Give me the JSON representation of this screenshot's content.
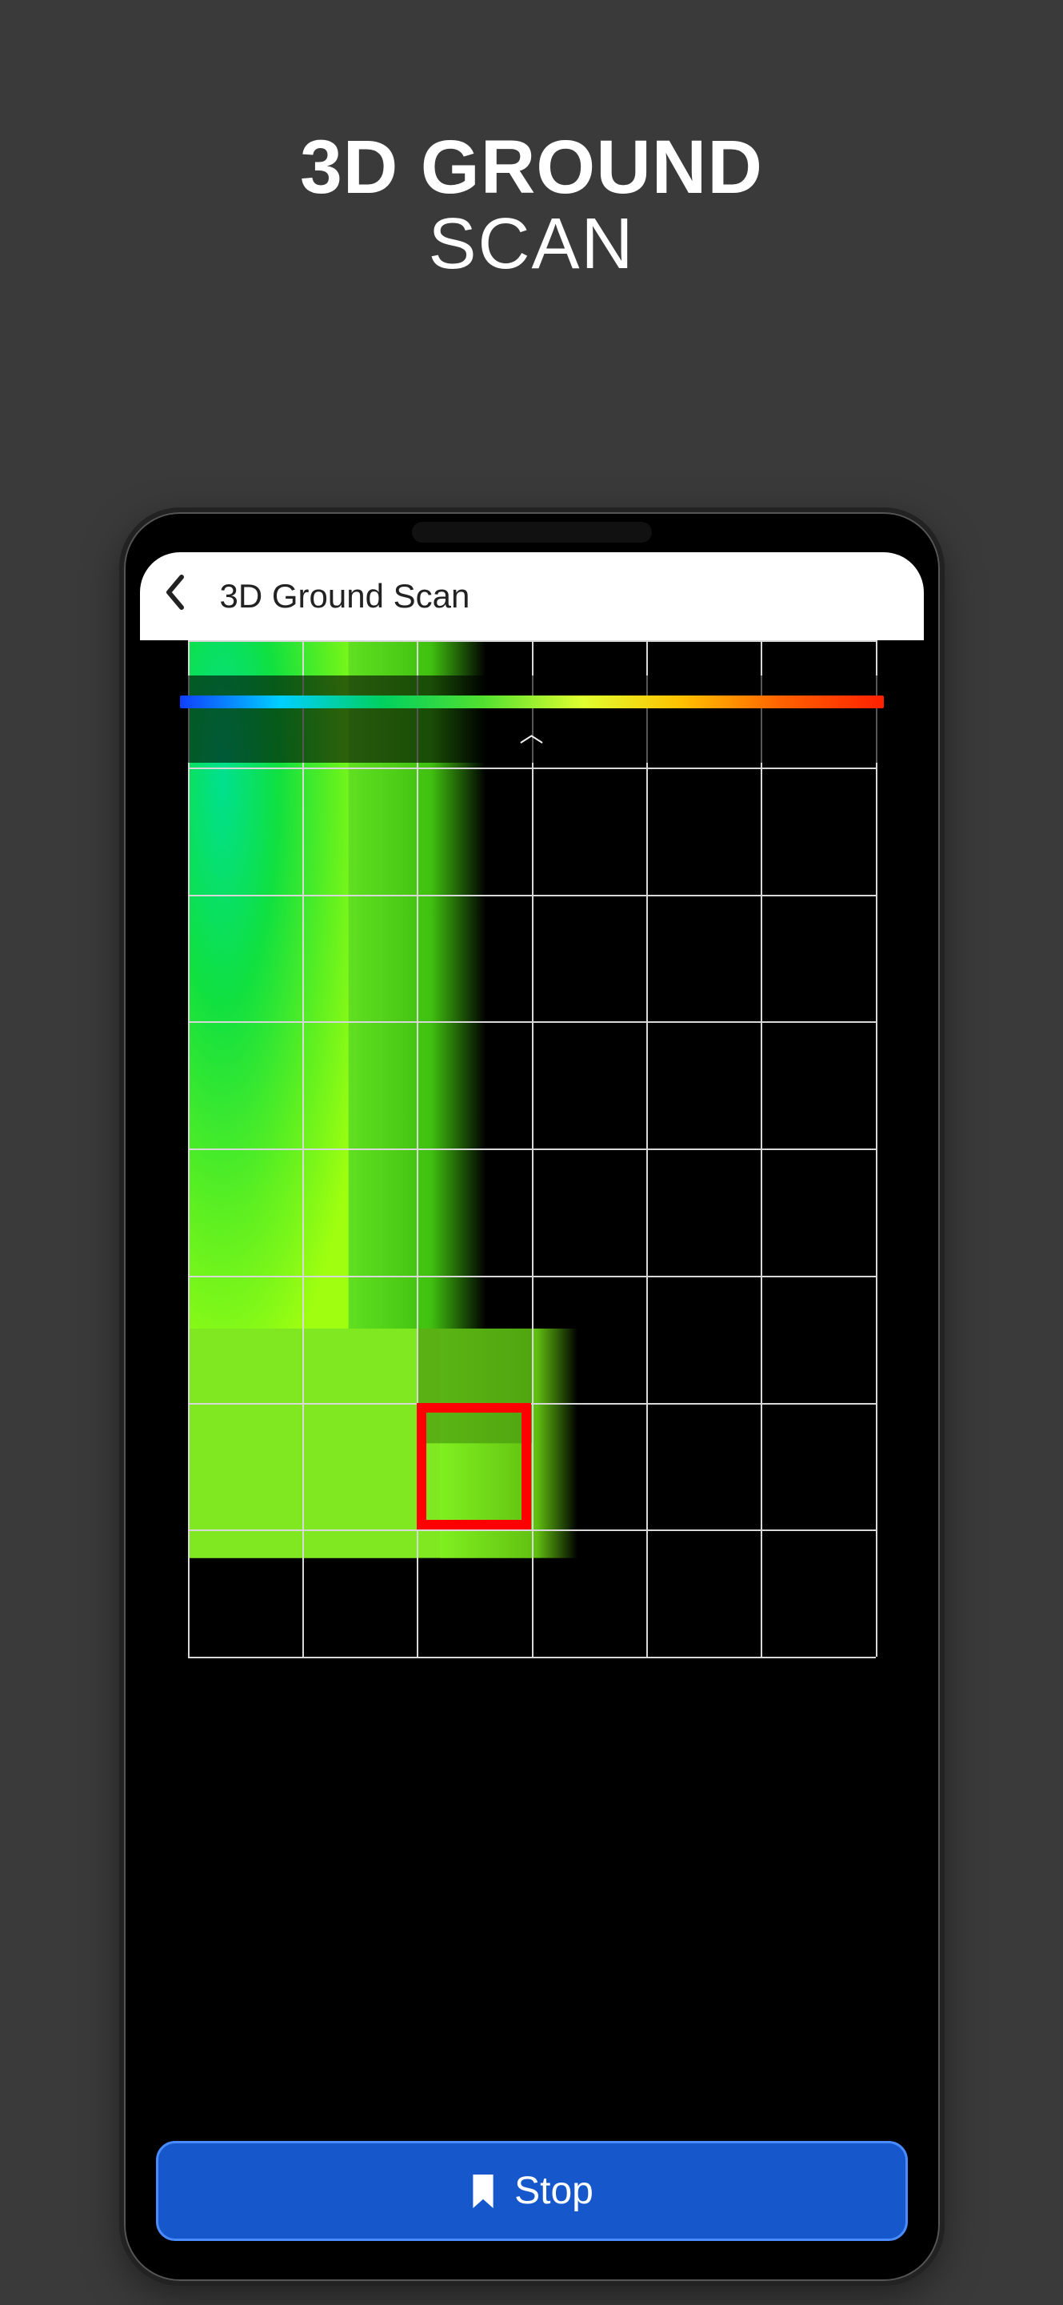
{
  "promo": {
    "title_line1": "3D GROUND",
    "title_line2": "SCAN"
  },
  "header": {
    "title": "3D Ground Scan"
  },
  "legend": {
    "expand_glyph": "︿",
    "colors": [
      "#1040ff",
      "#00d0ff",
      "#00d060",
      "#50e030",
      "#e0ff30",
      "#ffc000",
      "#ff6000",
      "#ff2000"
    ]
  },
  "scan": {
    "grid_cols": 6,
    "grid_rows": 8,
    "cursor": {
      "col": 2,
      "row": 6
    }
  },
  "actions": {
    "stop_label": "Stop"
  }
}
